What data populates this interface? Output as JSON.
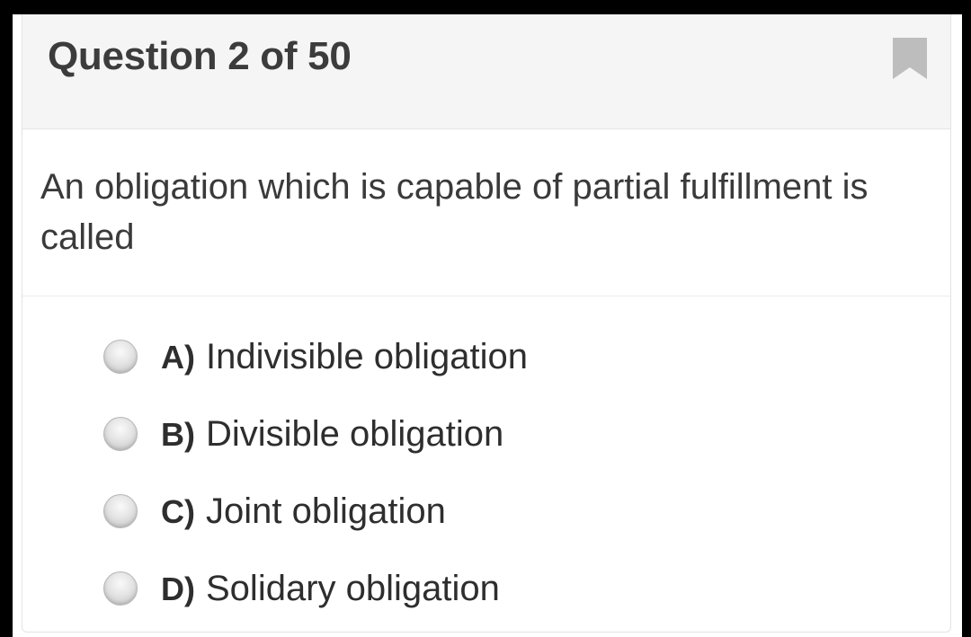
{
  "header": {
    "title": "Question 2 of 50",
    "bookmark_icon": "bookmark-icon"
  },
  "question": {
    "text": "An obligation which is capable of partial fulfillment is called"
  },
  "options": [
    {
      "letter": "A)",
      "label": "Indivisible obligation"
    },
    {
      "letter": "B)",
      "label": "Divisible obligation"
    },
    {
      "letter": "C)",
      "label": "Joint obligation"
    },
    {
      "letter": "D)",
      "label": "Solidary obligation"
    }
  ],
  "colors": {
    "header_bg": "#f5f5f5",
    "bookmark": "#bdbdbd",
    "text": "#3a3a3a"
  }
}
